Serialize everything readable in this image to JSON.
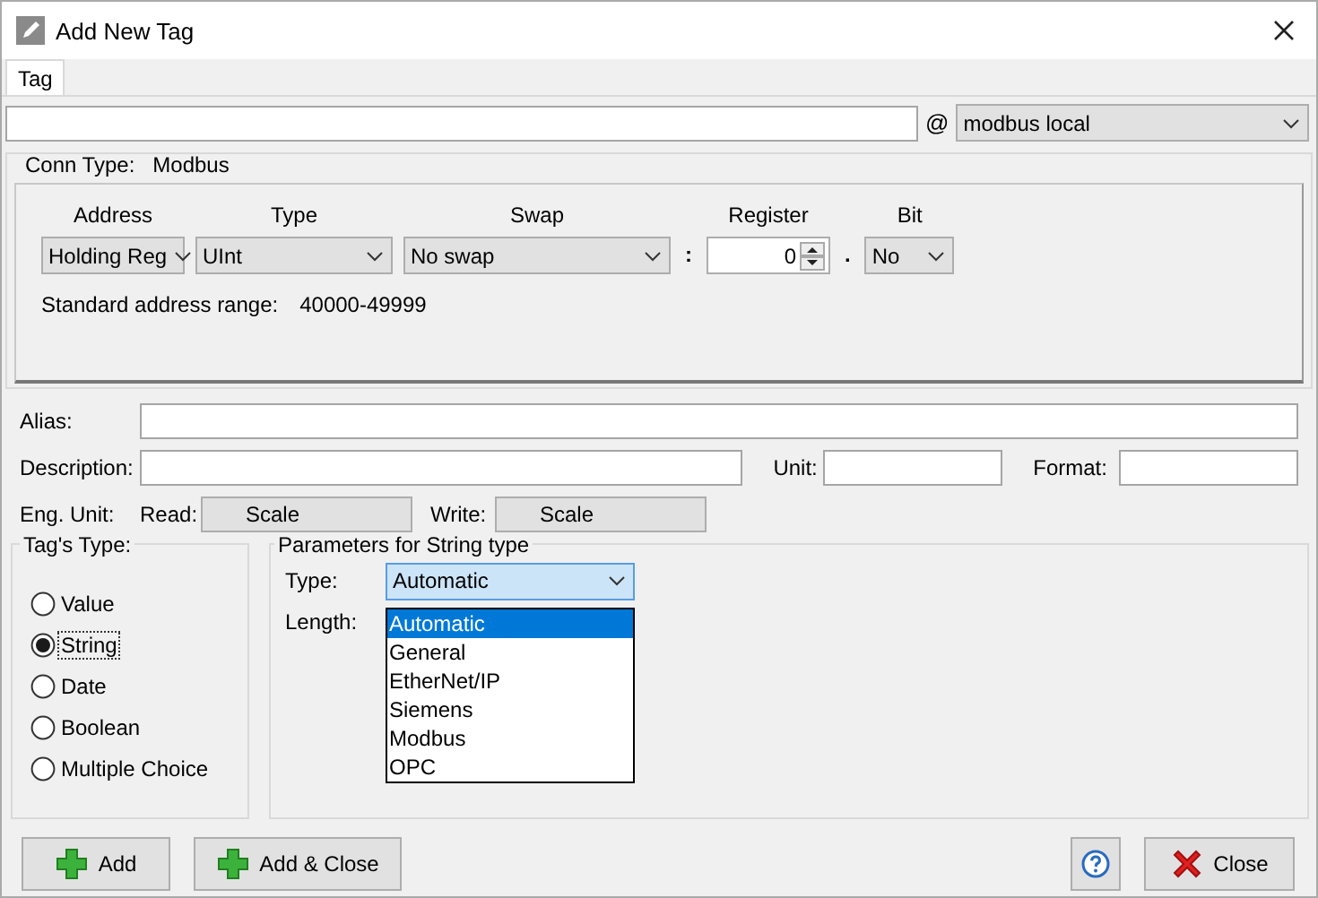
{
  "window": {
    "title": "Add New Tag"
  },
  "tabs": [
    {
      "label": "Tag",
      "selected": true
    }
  ],
  "at_sign": "@",
  "connection": {
    "value": "modbus local"
  },
  "conn_type": {
    "label": "Conn Type:",
    "value": "Modbus"
  },
  "address_fields": [
    {
      "label": "Address",
      "kind": "dropdown",
      "value": "Holding Reg"
    },
    {
      "label": "Type",
      "kind": "dropdown",
      "value": "UInt"
    },
    {
      "label": "Swap",
      "kind": "dropdown",
      "value": "No swap"
    },
    {
      "label": "Register",
      "kind": "spinner",
      "value": "0",
      "prefix": ":"
    },
    {
      "label": "Bit",
      "kind": "dropdown",
      "value": "No",
      "prefix": "."
    }
  ],
  "address_range": {
    "label": "Standard address range:",
    "value": "40000-49999"
  },
  "alias": {
    "label": "Alias:"
  },
  "description": {
    "label": "Description:"
  },
  "unit": {
    "label": "Unit:"
  },
  "format": {
    "label": "Format:"
  },
  "eng_unit": {
    "label": "Eng. Unit:",
    "read_label": "Read:",
    "read_value": "Scale",
    "write_label": "Write:",
    "write_value": "Scale"
  },
  "tags_type": {
    "title": "Tag's Type:",
    "options": [
      {
        "label": "Value",
        "selected": false
      },
      {
        "label": "String",
        "selected": true
      },
      {
        "label": "Date",
        "selected": false
      },
      {
        "label": "Boolean",
        "selected": false
      },
      {
        "label": "Multiple Choice",
        "selected": false
      }
    ]
  },
  "string_params": {
    "title": "Parameters for String type",
    "type_label": "Type:",
    "type_value": "Automatic",
    "length_label": "Length:",
    "expanded": true,
    "options": [
      {
        "label": "Automatic",
        "selected": true
      },
      {
        "label": "General",
        "selected": false
      },
      {
        "label": "EtherNet/IP",
        "selected": false
      },
      {
        "label": "Siemens",
        "selected": false
      },
      {
        "label": "Modbus",
        "selected": false
      },
      {
        "label": "OPC",
        "selected": false
      }
    ]
  },
  "buttons": [
    {
      "kind": "add",
      "label": "Add"
    },
    {
      "kind": "add",
      "label": "Add & Close"
    },
    {
      "kind": "help"
    },
    {
      "kind": "close",
      "label": "Close"
    }
  ]
}
